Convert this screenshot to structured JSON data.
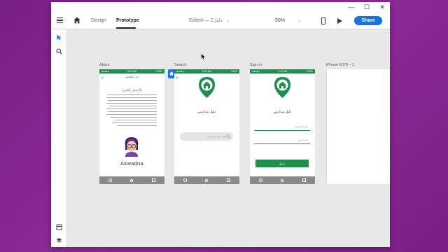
{
  "window_controls": {
    "minimize": "—",
    "maximize": "☐",
    "close": "✕"
  },
  "toolbar": {
    "design_tab": "Design",
    "prototype_tab": "Prototype",
    "doc_title": "Edited — دليل2",
    "doc_chevron": "⌄",
    "zoom": "50%",
    "zoom_chevron": "⌄",
    "share_label": "Share"
  },
  "artboards": {
    "about": {
      "label": "About",
      "status_left": "●●●●●",
      "status_time": "9:41 AM",
      "status_right": "100%",
      "header": "عن التطبيق",
      "subtitle": "(الإصدار الثاني)",
      "brand": "Akwadna"
    },
    "search": {
      "label": "Search",
      "status_left": "●●●●●",
      "status_time": "9:41 AM",
      "status_right": "100%",
      "app_name": "دليل مدارس",
      "search_placeholder": "ابحث عن المدرسة"
    },
    "signin": {
      "label": "Sign in",
      "status_left": "●●●●●",
      "status_time": "9:41 AM",
      "status_right": "100%",
      "app_name": "دليل مدارس",
      "field1": "البريد الإلكتروني",
      "field2": "كلمة المرور",
      "button": "دخول"
    },
    "iphone": {
      "label": "iPhone 6/7/8 – 1"
    }
  },
  "colors": {
    "accent": "#1473e6",
    "app_green": "#1f8f4c",
    "nav_gray": "#8a8a8a",
    "background": "#8f2a9a"
  }
}
